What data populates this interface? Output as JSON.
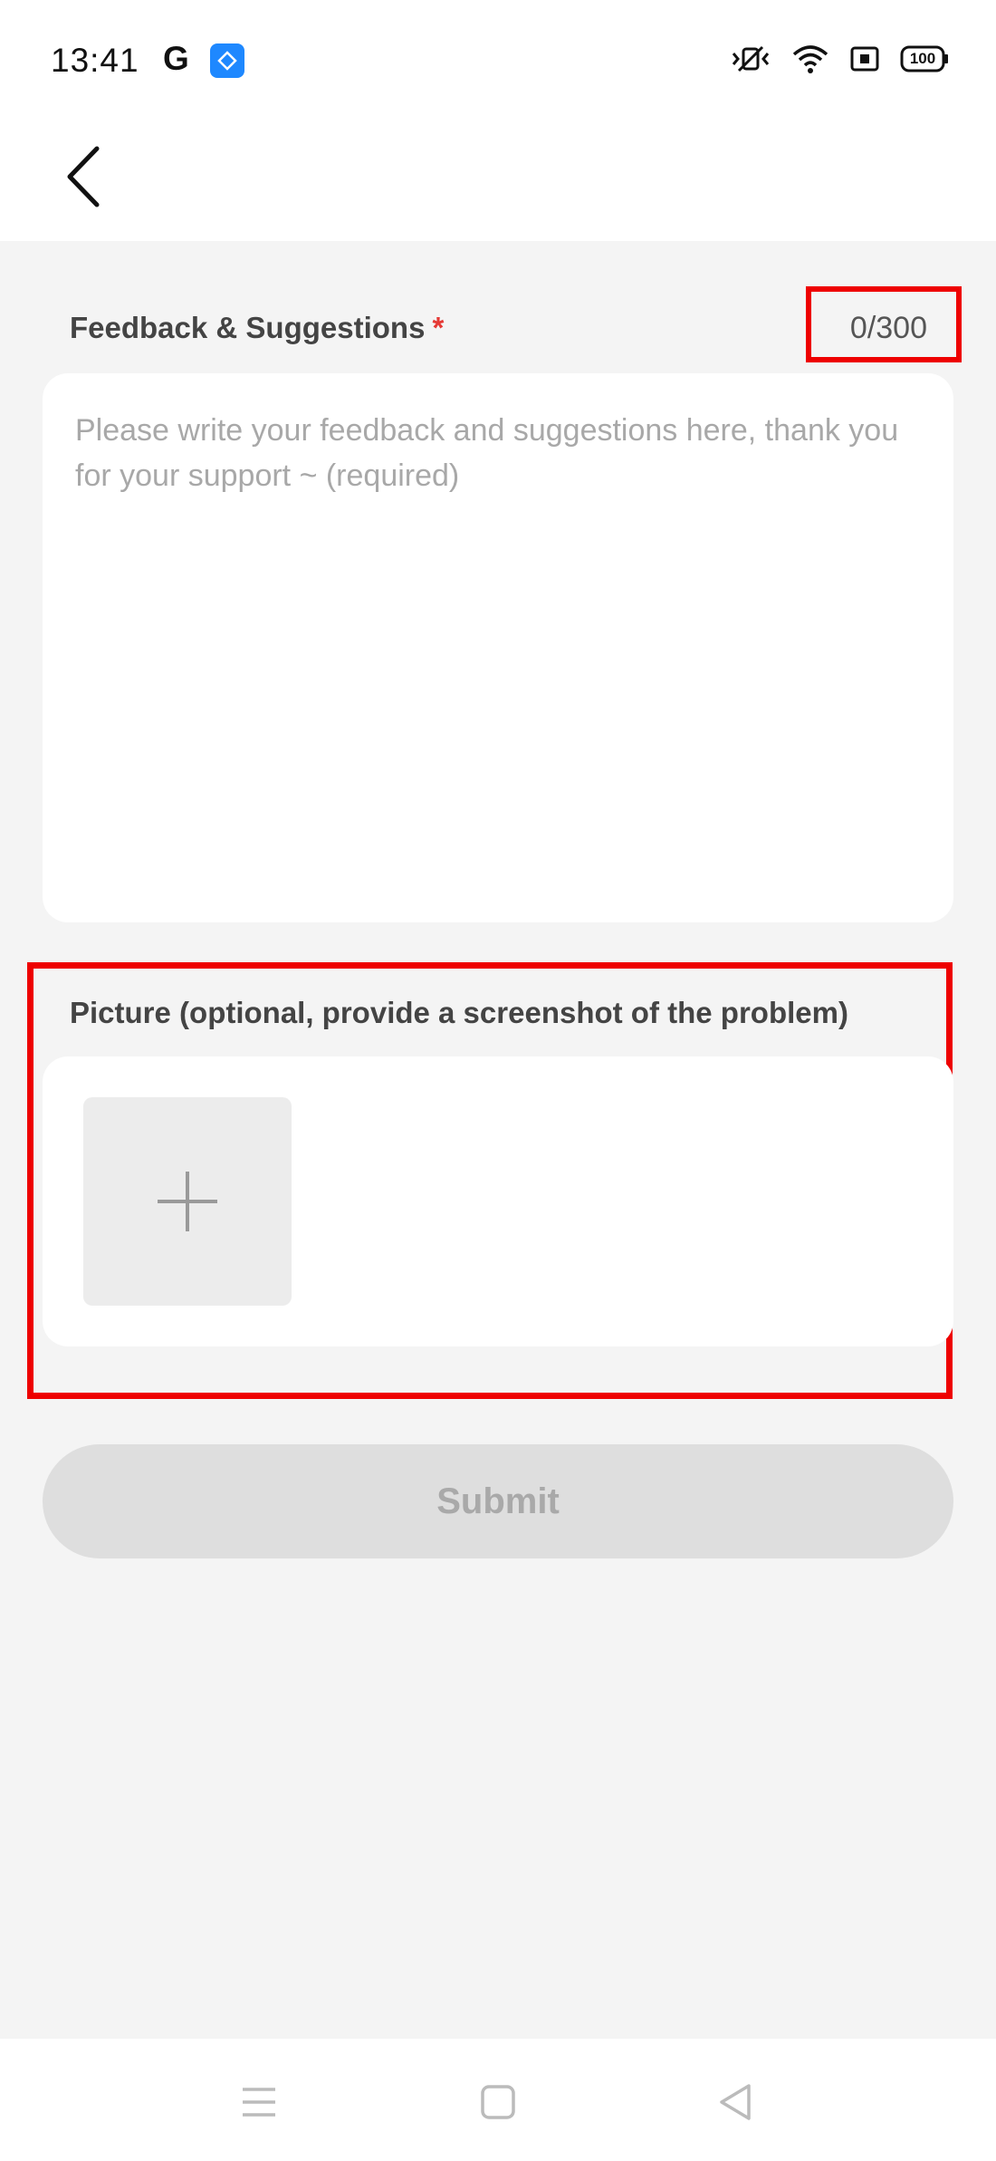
{
  "status_bar": {
    "time": "13:41",
    "google_letter": "G",
    "battery": "100",
    "icons": [
      "google-icon",
      "app-badge-icon",
      "vibrate-icon",
      "wifi-icon",
      "screen-record-icon",
      "battery-icon"
    ]
  },
  "header": {
    "back_icon": "chevron-left-icon"
  },
  "feedback": {
    "label": "Feedback & Suggestions",
    "required_mark": "*",
    "counter": "0/300",
    "value": "",
    "placeholder": "Please write your feedback and suggestions here, thank you for your support ~ (required)"
  },
  "picture": {
    "label": "Picture (optional, provide a screenshot of the problem)",
    "add_icon": "plus-icon"
  },
  "submit": {
    "label": "Submit"
  },
  "nav_bar": {
    "icons": [
      "menu-icon",
      "home-icon",
      "back-triangle-icon"
    ]
  },
  "colors": {
    "background": "#f4f4f4",
    "card": "#ffffff",
    "highlight": "#ee0000",
    "required": "#e53935",
    "submit_disabled_bg": "#dedede",
    "submit_disabled_text": "#a9a9a9",
    "app_badge": "#1e88ff"
  }
}
